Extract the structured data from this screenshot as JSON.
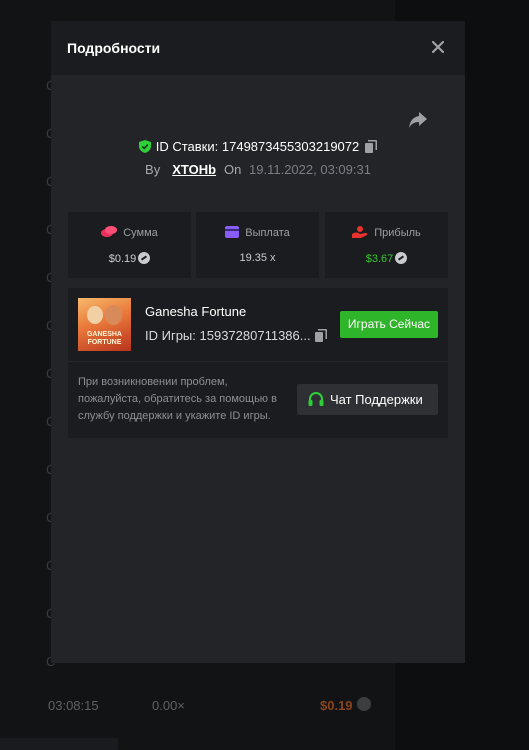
{
  "background": {
    "row": {
      "time": "03:08:15",
      "multiplier": "0.00×",
      "amount": "$0.19"
    }
  },
  "modal": {
    "title": "Подробности",
    "bet_id_label": "ID Ставки:",
    "bet_id": "1749873455303219072",
    "by_label": "By",
    "username": "XTOHb",
    "on_label": "On",
    "datetime": "19.11.2022, 03:09:31",
    "stats": [
      {
        "label": "Сумма",
        "value": "$0.19",
        "icon": "coins-icon",
        "color": "#e8325a"
      },
      {
        "label": "Выплата",
        "value": "19.35 x",
        "icon": "card-icon",
        "color": "#8a5cf6"
      },
      {
        "label": "Прибыль",
        "value": "$3.67",
        "icon": "hand-coin-icon",
        "color": "#e8322e"
      }
    ],
    "game": {
      "name": "Ganesha Fortune",
      "thumb_text": "GANESHA FORTUNE",
      "id_label": "ID Игры:",
      "id_value": "15937280711386...",
      "play_label": "Играть Сейчас"
    },
    "help_text": "При возникновении проблем, пожалуйста, обратитесь за помощью в службу поддержки и укажите ID игры.",
    "support_label": "Чат Поддержки"
  },
  "colors": {
    "accent_green": "#2fb52a",
    "profit_green": "#36c52f",
    "modal_bg": "#232428"
  }
}
